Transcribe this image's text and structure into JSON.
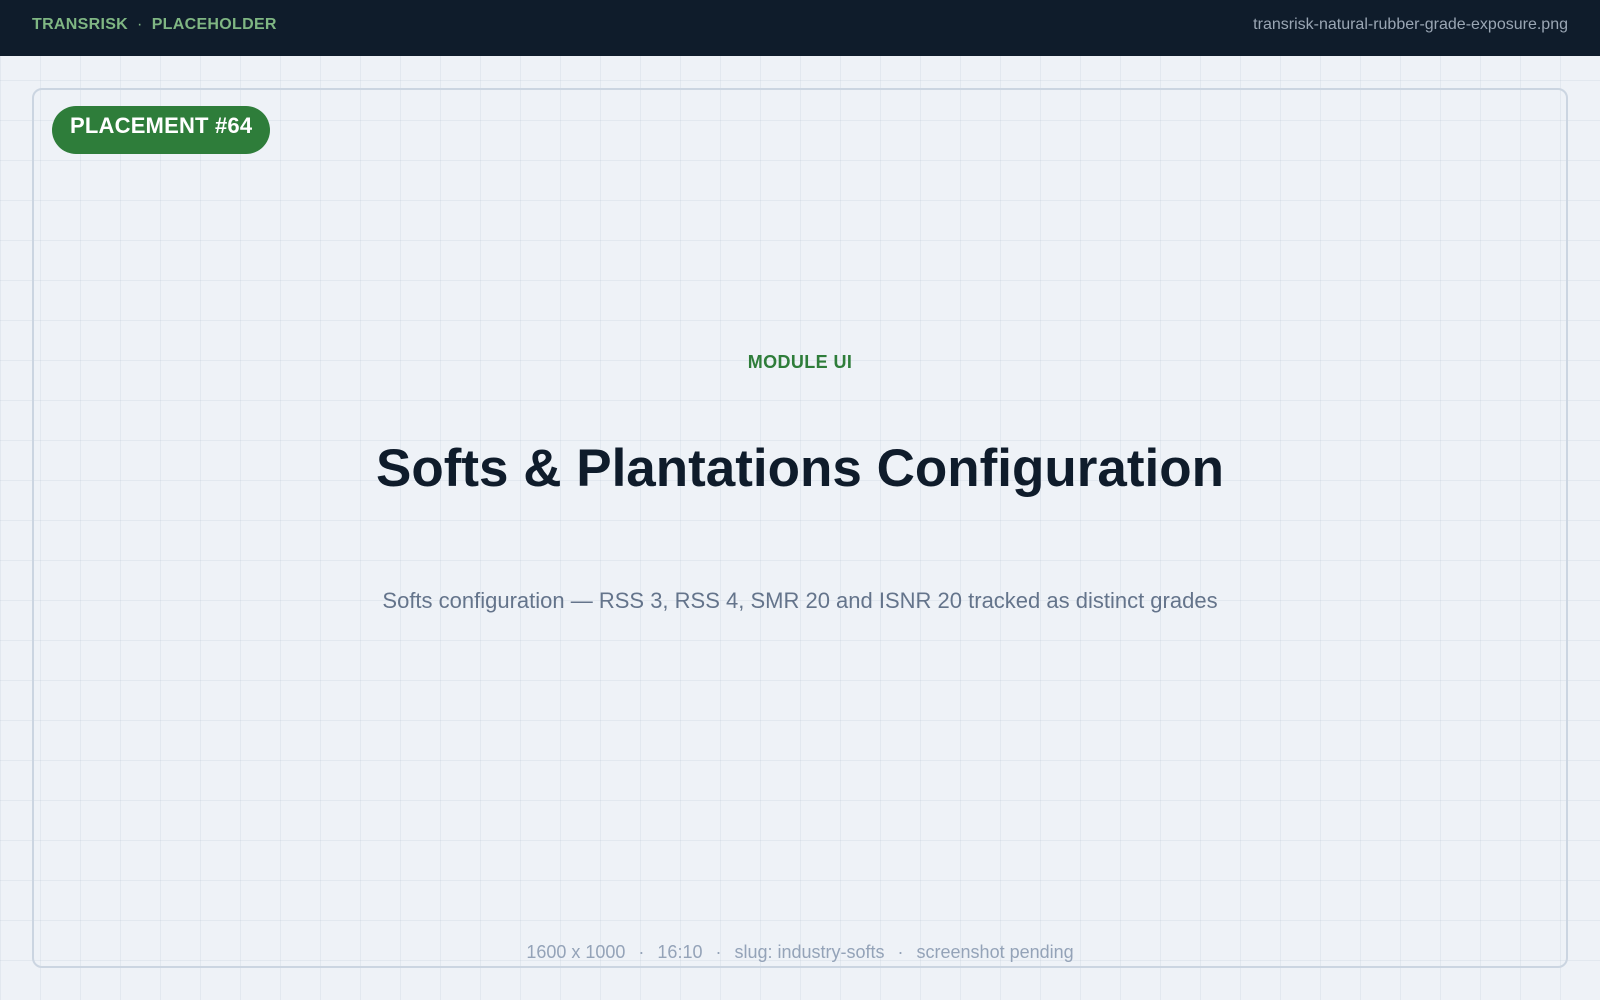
{
  "header": {
    "brand": "TRANSRISK",
    "separator": "·",
    "section": "PLACEHOLDER",
    "filename": "transrisk-natural-rubber-grade-exposure.png"
  },
  "card": {
    "badge": "PLACEMENT #64",
    "kicker": "MODULE UI",
    "title": "Softs & Plantations Configuration",
    "subtitle": "Softs configuration — RSS 3, RSS 4, SMR 20 and ISNR 20 tracked as distinct grades"
  },
  "footer": {
    "separator": "·",
    "dimensions": "1600 x 1000",
    "aspect_ratio": "16:10",
    "slug": "slug: industry-softs",
    "status": "screenshot pending"
  },
  "colors": {
    "topbar_bg": "#0f1c2b",
    "accent_green": "#2e7d3a",
    "page_bg": "#eef2f7"
  }
}
